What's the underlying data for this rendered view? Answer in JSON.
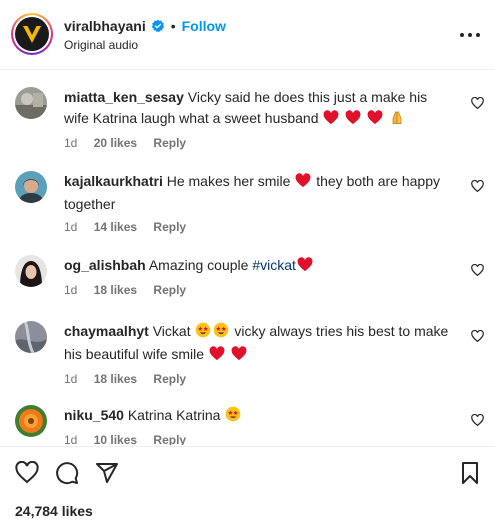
{
  "header": {
    "username": "viralbhayani",
    "separator": "•",
    "follow_label": "Follow",
    "subtitle": "Original audio",
    "verified_color": "#0095f6"
  },
  "comments": [
    {
      "username": "miatta_ken_sesay",
      "text": "Vicky said he does this just a make his wife Katrina laugh what a sweet husband",
      "emojis": [
        "red-heart",
        "red-heart",
        "red-heart",
        "praying-hands"
      ],
      "time": "1d",
      "likes": "20 likes",
      "reply": "Reply"
    },
    {
      "username": "kajalkaurkhatri",
      "text_before": "He makes her smile",
      "text_after": "they both are happy together",
      "emojis": [
        "red-heart"
      ],
      "time": "1d",
      "likes": "14 likes",
      "reply": "Reply"
    },
    {
      "username": "og_alishbah",
      "text": "Amazing couple",
      "hashtag": "#vickat",
      "emojis": [
        "red-heart"
      ],
      "time": "1d",
      "likes": "18 likes",
      "reply": "Reply"
    },
    {
      "username": "chaymaalhyt",
      "text_before": "Vickat",
      "text_after": "vicky always tries his best to make his beautiful wife smile",
      "emojis": [
        "star-struck",
        "star-struck",
        "red-heart",
        "red-heart"
      ],
      "time": "1d",
      "likes": "18 likes",
      "reply": "Reply"
    },
    {
      "username": "niku_540",
      "text": "Katrina Katrina",
      "emojis": [
        "star-struck"
      ],
      "time": "1d",
      "likes": "10 likes",
      "reply": "Reply"
    }
  ],
  "footer": {
    "likes_count": "24,784 likes"
  },
  "colors": {
    "link": "#0095f6",
    "hashtag": "#00376b",
    "muted": "#737373",
    "heart": "#e0112b"
  }
}
